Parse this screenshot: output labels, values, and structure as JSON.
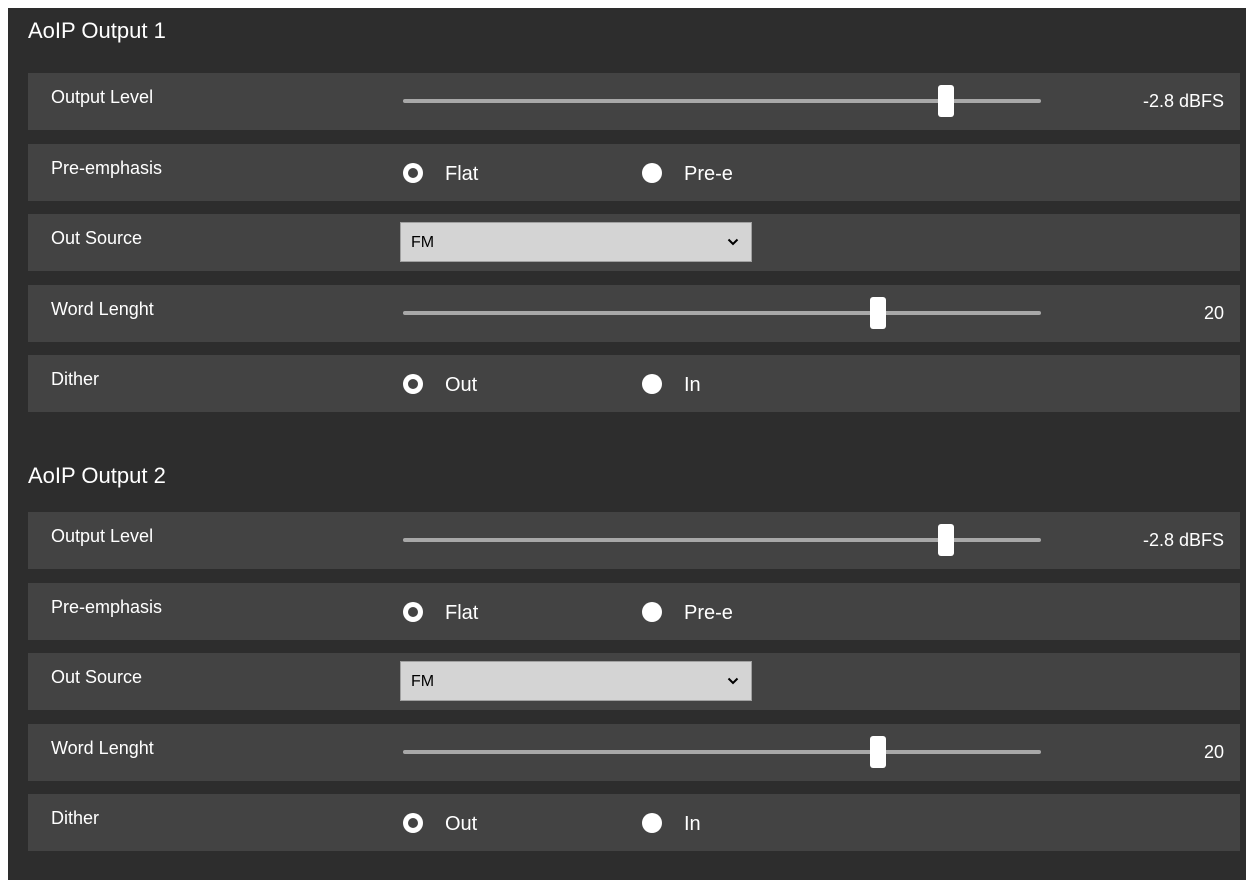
{
  "sections": [
    {
      "title": "AoIP Output 1",
      "output_level": {
        "label": "Output Level",
        "value_text": "-2.8 dBFS",
        "slider_fraction": 0.851
      },
      "pre_emphasis": {
        "label": "Pre-emphasis",
        "options": [
          "Flat",
          "Pre-e"
        ],
        "selected": "Flat"
      },
      "out_source": {
        "label": "Out Source",
        "selected": "FM"
      },
      "word_length": {
        "label": "Word Lenght",
        "value_text": "20",
        "slider_fraction": 0.745
      },
      "dither": {
        "label": "Dither",
        "options": [
          "Out",
          "In"
        ],
        "selected": "Out"
      }
    },
    {
      "title": "AoIP Output 2",
      "output_level": {
        "label": "Output Level",
        "value_text": "-2.8 dBFS",
        "slider_fraction": 0.851
      },
      "pre_emphasis": {
        "label": "Pre-emphasis",
        "options": [
          "Flat",
          "Pre-e"
        ],
        "selected": "Flat"
      },
      "out_source": {
        "label": "Out Source",
        "selected": "FM"
      },
      "word_length": {
        "label": "Word Lenght",
        "value_text": "20",
        "slider_fraction": 0.745
      },
      "dither": {
        "label": "Dither",
        "options": [
          "Out",
          "In"
        ],
        "selected": "Out"
      }
    }
  ],
  "icons": {
    "dropdown": "chevron-down-icon"
  },
  "colors": {
    "panel_bg": "#2d2d2d",
    "row_bg": "#434343",
    "text": "#ffffff",
    "slider_track": "#a8a8a8",
    "select_bg": "#d4d4d4"
  }
}
